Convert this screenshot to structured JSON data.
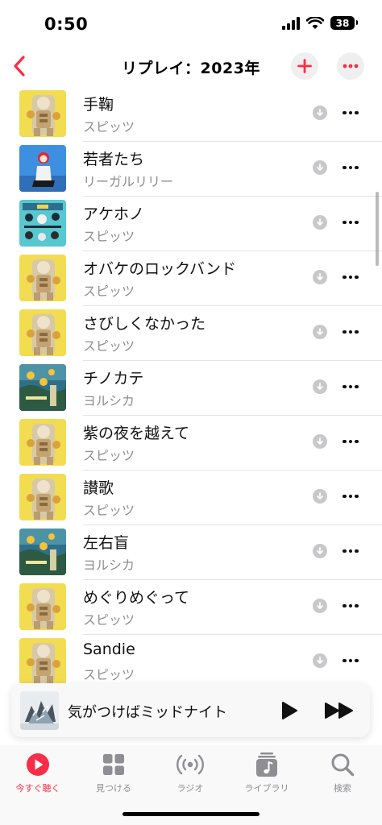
{
  "status_bar": {
    "time": "0:50",
    "battery": "38"
  },
  "header": {
    "title": "リプレイ：2023年"
  },
  "colors": {
    "accent": "#fa2d48",
    "secondary_text": "#8e8e93"
  },
  "songs": [
    {
      "title": "手鞠",
      "artist": "スピッツ",
      "art": "spitz"
    },
    {
      "title": "若者たち",
      "artist": "リーガルリリー",
      "art": "regal"
    },
    {
      "title": "アケホノ",
      "artist": "スピッツ",
      "art": "akehono"
    },
    {
      "title": "オバケのロックバンド",
      "artist": "スピッツ",
      "art": "spitz"
    },
    {
      "title": "さびしくなかった",
      "artist": "スピッツ",
      "art": "spitz"
    },
    {
      "title": "チノカテ",
      "artist": "ヨルシカ",
      "art": "yorushika"
    },
    {
      "title": "紫の夜を越えて",
      "artist": "スピッツ",
      "art": "spitz"
    },
    {
      "title": "讃歌",
      "artist": "スピッツ",
      "art": "spitz"
    },
    {
      "title": "左右盲",
      "artist": "ヨルシカ",
      "art": "yorushika"
    },
    {
      "title": "めぐりめぐって",
      "artist": "スピッツ",
      "art": "spitz"
    },
    {
      "title": "Sandie",
      "artist": "スピッツ",
      "art": "spitz"
    }
  ],
  "now_playing": {
    "title": "気がつけばミッドナイト"
  },
  "tabs": [
    {
      "label": "今すぐ聴く",
      "icon": "play-circle-icon",
      "active": true
    },
    {
      "label": "見つける",
      "icon": "grid-icon",
      "active": false
    },
    {
      "label": "ラジオ",
      "icon": "radio-icon",
      "active": false
    },
    {
      "label": "ライブラリ",
      "icon": "library-icon",
      "active": false
    },
    {
      "label": "検索",
      "icon": "search-icon",
      "active": false
    }
  ]
}
